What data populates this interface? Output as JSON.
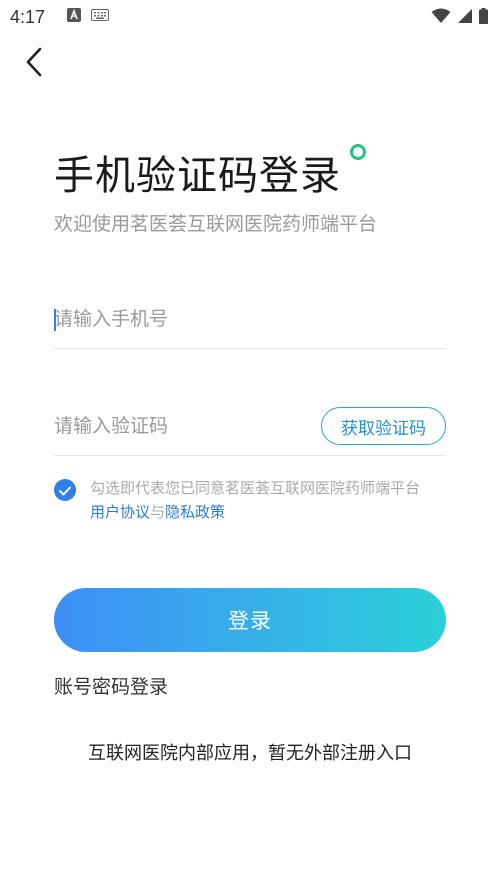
{
  "status_bar": {
    "time": "4:17",
    "icons": [
      "a-notification-icon",
      "keyboard-icon",
      "wifi-icon",
      "signal-icon",
      "battery-icon"
    ]
  },
  "header": {
    "back_icon": "chevron-left-icon"
  },
  "title": "手机验证码登录",
  "subtitle": "欢迎使用茗医荟互联网医院药师端平台",
  "phone_input": {
    "value": "",
    "placeholder": "请输入手机号"
  },
  "code_input": {
    "value": "",
    "placeholder": "请输入验证码",
    "get_code_label": "获取验证码"
  },
  "agreement": {
    "checked": true,
    "prefix": "勾选即代表您已同意茗医荟互联网医院药师端平台",
    "user_agreement": "用户协议",
    "connector": "与",
    "privacy_policy": "隐私政策"
  },
  "login_button_label": "登录",
  "password_login_label": "账号密码登录",
  "footer_note": "互联网医院内部应用，暂无外部注册入口",
  "colors": {
    "accent_blue": "#2f7fe8",
    "gradient_start": "#3e8ef7",
    "gradient_end": "#2bd0d6",
    "dot_green": "#27c27f",
    "link_blue": "#2a7fd6"
  }
}
